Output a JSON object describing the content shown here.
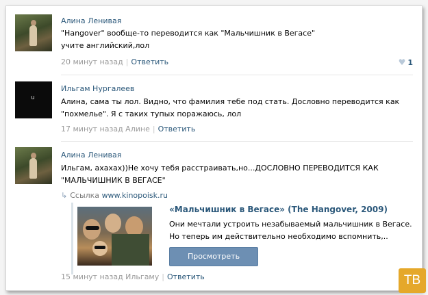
{
  "comments": [
    {
      "author": "Алина Ленивая",
      "lines": [
        "\"Hangover\" вообще-то переводится как \"Мальчишник в Вегасе\"",
        "учите английский,лол"
      ],
      "time": "20 минут назад",
      "reply": "Ответить",
      "likes": "1"
    },
    {
      "author": "Ильгам Нургалеев",
      "avatar_text": "u",
      "lines": [
        "Алина, сама ты лол. Видно, что фамилия тебе под стать. Дословно переводится как",
        "\"похмелье\". Я с таких тупых поражаюсь, лол"
      ],
      "time": "17 минут назад Алине",
      "reply": "Ответить"
    },
    {
      "author": "Алина Ленивая",
      "lines": [
        "Ильгам, ахахах))Не хочу тебя расстраивать,но...ДОСЛОВНО ПЕРЕВОДИТСЯ КАК",
        "\"МАЛЬЧИШНИК В ВЕГАСЕ\""
      ],
      "link_label": "Ссылка",
      "link_url": "www.kinopoisk.ru",
      "movie_title": "«Мальчишник в Вегасе» (The Hangover, 2009)",
      "movie_desc": [
        "Они мечтали устроить незабываемый мальчишник в Вегасе.",
        "Но теперь им действительно необходимо вспомнить,.."
      ],
      "watch_button": "Просмотреть",
      "time": "15 минут назад Ильгаму",
      "reply": "Ответить"
    }
  ],
  "watermark": "ТВ",
  "colors": {
    "link": "#2b587a",
    "button": "#6d8fb3",
    "watermark": "#e5a82a"
  }
}
